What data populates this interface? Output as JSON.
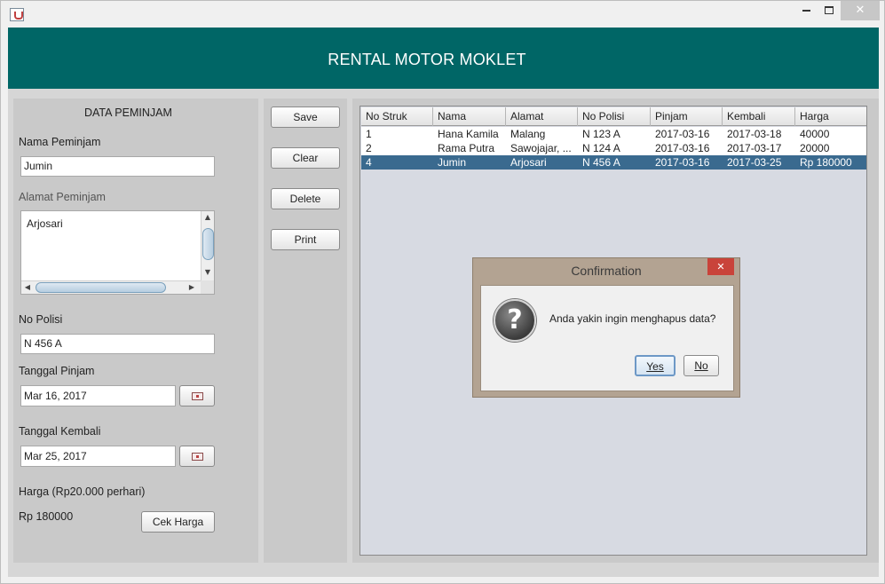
{
  "window": {
    "close_glyph": "✕"
  },
  "header": {
    "title": "RENTAL MOTOR MOKLET"
  },
  "form": {
    "section_title": "DATA PEMINJAM",
    "nama_label": "Nama Peminjam",
    "nama_value": "Jumin",
    "alamat_label": "Alamat Peminjam",
    "alamat_value": "Arjosari",
    "nopol_label": "No Polisi",
    "nopol_value": "N 456 A",
    "tgl_pinjam_label": "Tanggal Pinjam",
    "tgl_pinjam_value": "Mar 16, 2017",
    "tgl_kembali_label": "Tanggal Kembali",
    "tgl_kembali_value": "Mar 25, 2017",
    "harga_label": "Harga (Rp20.000 perhari)",
    "harga_value": "Rp 180000",
    "cek_harga": "Cek Harga"
  },
  "actions": {
    "save": "Save",
    "clear": "Clear",
    "delete": "Delete",
    "print": "Print"
  },
  "table": {
    "columns": [
      "No Struk",
      "Nama",
      "Alamat",
      "No Polisi",
      "Pinjam",
      "Kembali",
      "Harga"
    ],
    "rows": [
      [
        "1",
        "Hana Kamila",
        "Malang",
        "N 123 A",
        "2017-03-16",
        "2017-03-18",
        "40000"
      ],
      [
        "2",
        "Rama Putra",
        "Sawojajar, ...",
        "N 124 A",
        "2017-03-16",
        "2017-03-17",
        "20000"
      ],
      [
        "4",
        "Jumin",
        "Arjosari",
        "N 456 A",
        "2017-03-16",
        "2017-03-25",
        "Rp 180000"
      ]
    ],
    "selected_row": 3
  },
  "dialog": {
    "title": "Confirmation",
    "close_glyph": "✕",
    "icon_glyph": "?",
    "message": "Anda yakin ingin menghapus data?",
    "yes": "Yes",
    "no": "No"
  },
  "colors": {
    "header_bg": "#006666",
    "selection": "#3a6a8f",
    "dialog_frame": "#b3a392"
  }
}
